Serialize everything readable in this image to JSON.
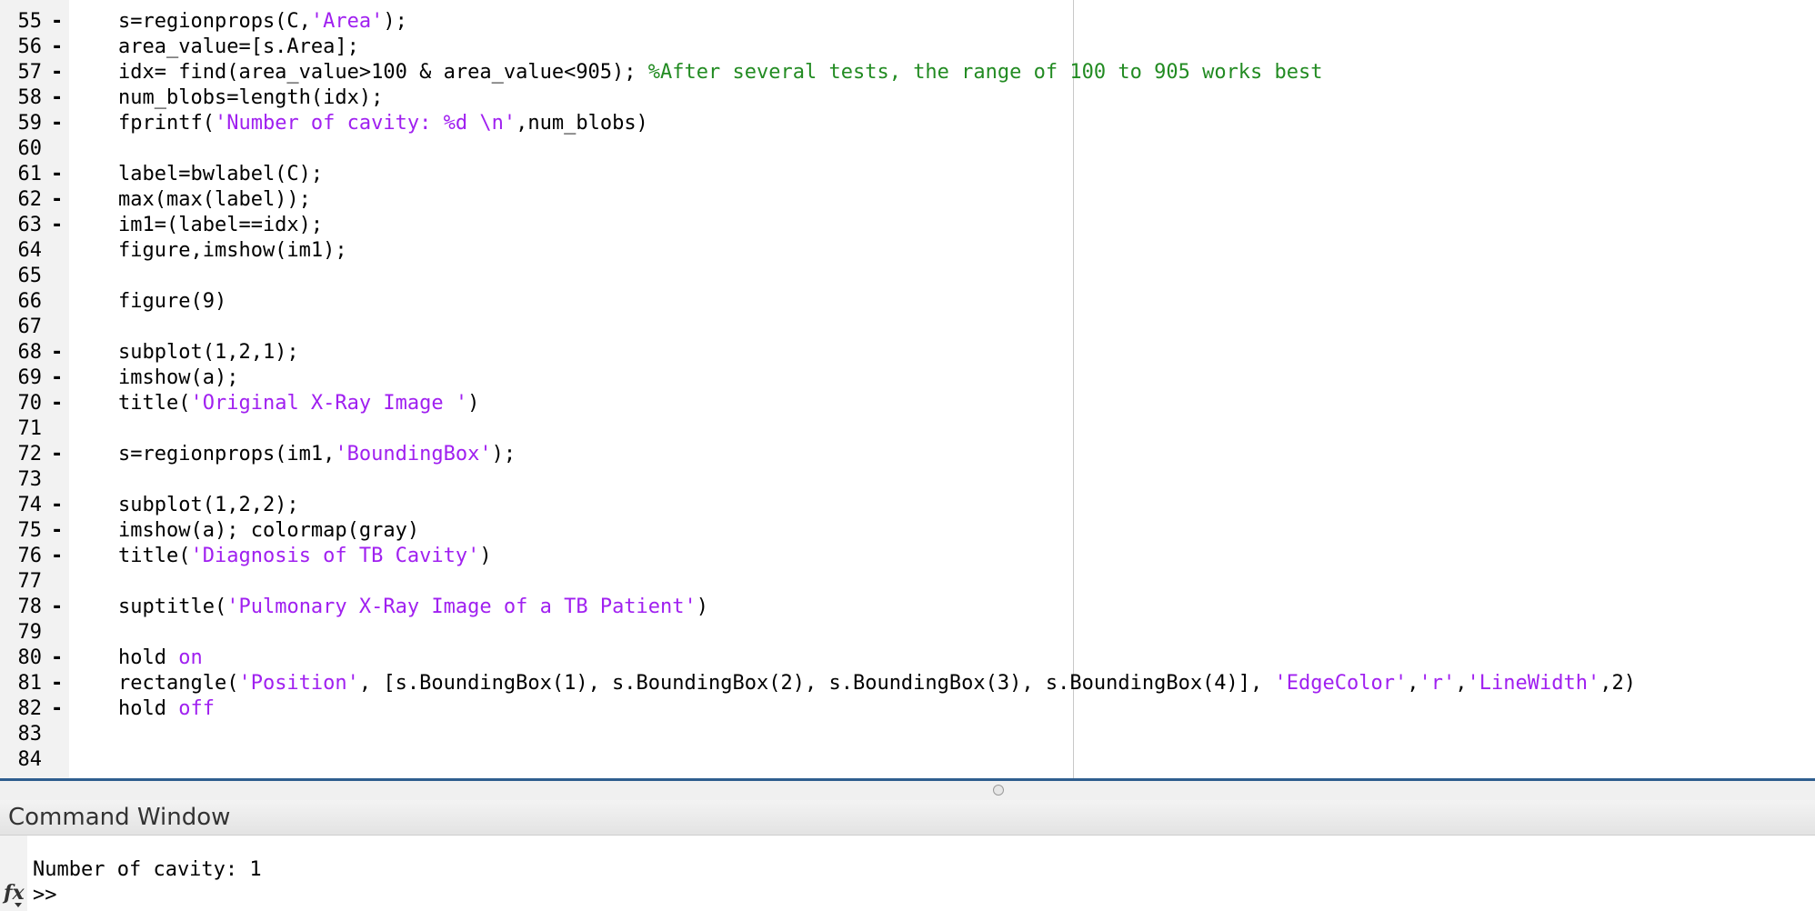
{
  "editor": {
    "lines": [
      {
        "num": "55",
        "bp": "-",
        "segs": [
          {
            "t": "s=regionprops(C,"
          },
          {
            "t": "'Area'",
            "c": "str"
          },
          {
            "t": ");"
          }
        ]
      },
      {
        "num": "56",
        "bp": "-",
        "segs": [
          {
            "t": "area_value=[s.Area];"
          }
        ]
      },
      {
        "num": "57",
        "bp": "-",
        "segs": [
          {
            "t": "idx= find(area_value>100 & area_value<905); "
          },
          {
            "t": "%After several tests, the range of 100 to 905 works best",
            "c": "cmt"
          }
        ]
      },
      {
        "num": "58",
        "bp": "-",
        "segs": [
          {
            "t": "num_blobs=length(idx);"
          }
        ]
      },
      {
        "num": "59",
        "bp": "-",
        "segs": [
          {
            "t": "fprintf("
          },
          {
            "t": "'Number of cavity: %d \\n'",
            "c": "str"
          },
          {
            "t": ",num_blobs)"
          }
        ]
      },
      {
        "num": "60",
        "bp": "",
        "segs": []
      },
      {
        "num": "61",
        "bp": "-",
        "segs": [
          {
            "t": "label=bwlabel(C);"
          }
        ]
      },
      {
        "num": "62",
        "bp": "-",
        "segs": [
          {
            "t": "max(max(label));"
          }
        ]
      },
      {
        "num": "63",
        "bp": "-",
        "segs": [
          {
            "t": "im1=(label==idx);"
          }
        ]
      },
      {
        "num": "64",
        "bp": "",
        "segs": [
          {
            "t": "figure,imshow(im1);"
          }
        ]
      },
      {
        "num": "65",
        "bp": "",
        "segs": []
      },
      {
        "num": "66",
        "bp": "",
        "segs": [
          {
            "t": "figure(9)"
          }
        ]
      },
      {
        "num": "67",
        "bp": "",
        "segs": []
      },
      {
        "num": "68",
        "bp": "-",
        "segs": [
          {
            "t": "subplot(1,2,1);"
          }
        ]
      },
      {
        "num": "69",
        "bp": "-",
        "segs": [
          {
            "t": "imshow(a);"
          }
        ]
      },
      {
        "num": "70",
        "bp": "-",
        "segs": [
          {
            "t": "title("
          },
          {
            "t": "'Original X-Ray Image '",
            "c": "str"
          },
          {
            "t": ")"
          }
        ]
      },
      {
        "num": "71",
        "bp": "",
        "segs": []
      },
      {
        "num": "72",
        "bp": "-",
        "segs": [
          {
            "t": "s=regionprops(im1,"
          },
          {
            "t": "'BoundingBox'",
            "c": "str"
          },
          {
            "t": ");"
          }
        ]
      },
      {
        "num": "73",
        "bp": "",
        "segs": []
      },
      {
        "num": "74",
        "bp": "-",
        "segs": [
          {
            "t": "subplot(1,2,2);"
          }
        ]
      },
      {
        "num": "75",
        "bp": "-",
        "segs": [
          {
            "t": "imshow(a); colormap(gray)"
          }
        ]
      },
      {
        "num": "76",
        "bp": "-",
        "segs": [
          {
            "t": "title("
          },
          {
            "t": "'Diagnosis of TB Cavity'",
            "c": "str"
          },
          {
            "t": ")"
          }
        ]
      },
      {
        "num": "77",
        "bp": "",
        "segs": []
      },
      {
        "num": "78",
        "bp": "-",
        "segs": [
          {
            "t": "suptitle("
          },
          {
            "t": "'Pulmonary X-Ray Image of a TB Patient'",
            "c": "str"
          },
          {
            "t": ")"
          }
        ]
      },
      {
        "num": "79",
        "bp": "",
        "segs": []
      },
      {
        "num": "80",
        "bp": "-",
        "segs": [
          {
            "t": "hold "
          },
          {
            "t": "on",
            "c": "kw"
          }
        ]
      },
      {
        "num": "81",
        "bp": "-",
        "segs": [
          {
            "t": "rectangle("
          },
          {
            "t": "'Position'",
            "c": "str"
          },
          {
            "t": ", [s.BoundingBox(1), s.BoundingBox(2), s.BoundingBox(3), s.BoundingBox(4)], "
          },
          {
            "t": "'EdgeColor'",
            "c": "str"
          },
          {
            "t": ","
          },
          {
            "t": "'r'",
            "c": "str"
          },
          {
            "t": ","
          },
          {
            "t": "'LineWidth'",
            "c": "str"
          },
          {
            "t": ",2)"
          }
        ]
      },
      {
        "num": "82",
        "bp": "-",
        "segs": [
          {
            "t": "hold "
          },
          {
            "t": "off",
            "c": "kw"
          }
        ]
      },
      {
        "num": "83",
        "bp": "",
        "segs": []
      },
      {
        "num": "84",
        "bp": "",
        "segs": []
      }
    ]
  },
  "command_window": {
    "title": "Command Window",
    "output": "Number of cavity: 1",
    "prompt": ">>",
    "fx_label": "fx"
  },
  "colors": {
    "string": "#a020f0",
    "comment": "#228b22",
    "keyword": "#a020f0",
    "splitter": "#2e5d8e"
  }
}
